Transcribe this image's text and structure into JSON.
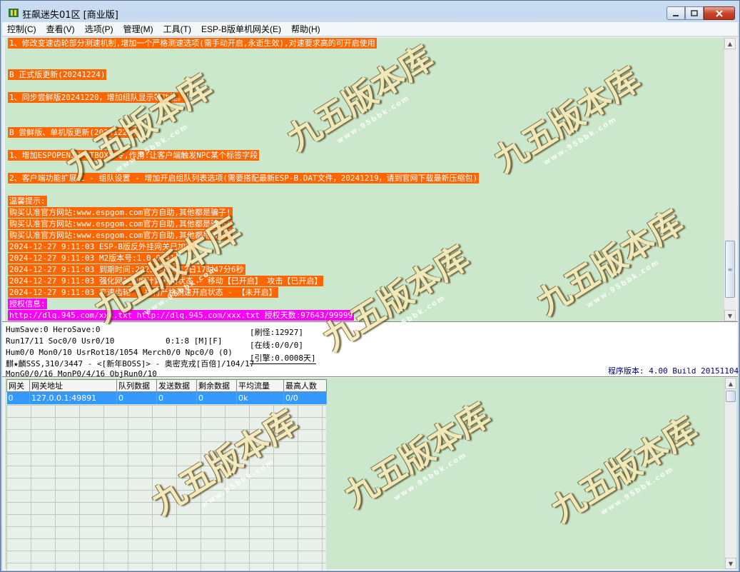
{
  "window": {
    "title": "狂飙迷失01区 [商业版]"
  },
  "menu": [
    "控制(C)",
    "查看(V)",
    "选项(P)",
    "管理(M)",
    "工具(T)",
    "ESP-B版单机网关(E)",
    "帮助(H)"
  ],
  "log": {
    "lines": [
      {
        "text": "1、修改变速齿轮部分测速机制,增加一个严格测速选项(需手动开启,永逝生效),对速要求高的可开启使用",
        "style": "orange"
      },
      {
        "text": "B 正式版更新(20241224)",
        "style": "orange"
      },
      {
        "text": "1、同步尝鲜版20241220，增加组队显示等功能。",
        "style": "orange"
      },
      {
        "text": "B 尝鲜版、单机版更新(20241220)",
        "style": "orange"
      },
      {
        "text": "1、增加ESPOPENINPUTBOX命令,作用:让客户端触发NPC某个标签字段",
        "style": "orange"
      },
      {
        "text": "2、客户端功能扩展二 - 组队设置 - 增加开启组队列表选项(需要搭配最新ESP-B.DAT文件，20241219，请到官网下载最新压缩包)",
        "style": "orange"
      },
      {
        "text": "温馨提示:",
        "style": "orange"
      },
      {
        "text": "购买认准官方网站:www.espgom.com官方自助,其他都是骗子!",
        "style": "orange"
      },
      {
        "text": "购买认准官方网站:www.espgom.com官方自助,其他都是骗子!",
        "style": "orange"
      },
      {
        "text": "购买认准官方网站:www.espgom.com官方自助,其他都是骗子!",
        "style": "orange"
      },
      {
        "text": "2024-12-27 9:11:03 ESP-B版反外挂网关已加载",
        "style": "orange"
      },
      {
        "text": "2024-12-27 9:11:03 M2版本号:1.0.0.41",
        "style": "orange"
      },
      {
        "text": "2024-12-27 9:11:03 到期时间:2025年11月12日17时47分6秒",
        "style": "orange"
      },
      {
        "text": "2024-12-27 9:11:03 强化网关速度计算开启状态 - 移动【已开启】 攻击【已开启】",
        "style": "orange"
      },
      {
        "text": "2024-12-27 9:11:03 变速齿轮 - 执行严格测速开启状态 - 【未开启】",
        "style": "orange"
      },
      {
        "text": "授权信息:",
        "style": "magenta"
      },
      {
        "text": "http://dlq.945.com/xxx.txt http://dlq.945.com/xxx.txt 授权天数:97643/99999",
        "style": "magenta"
      }
    ]
  },
  "status": {
    "hum_save": "HumSave:0 HeroSave:0",
    "run": "Run17/11 Soc0/0 Usr0/10",
    "time": "0:1:8 [M][F]",
    "hum": "Hum0/0 Mon0/10 UsrRot18/1054 Merch0/0 Npc0/0 (0)",
    "boss": "麒★麟SSS,310/3447 - <[新年BOSS]> - 奥密克戎[百倍]/104/17",
    "mon": "MonG0/0/16 MonP0/4/16 ObjRun0/10",
    "brush": "[刷怪:12927]",
    "online": "[在线:0/0/0]",
    "engine": "[引擎:0.0008天]",
    "version": "程序版本: 4.00 Build 20151104"
  },
  "gateway_table": {
    "headers": [
      "网关",
      "网关地址",
      "队列数据",
      "发送数据",
      "剩余数据",
      "平均流量",
      "最高人数"
    ],
    "rows": [
      [
        "0",
        "127.0.0.1:49891",
        "0",
        "0",
        "0",
        "0k",
        "0/0"
      ]
    ]
  },
  "watermark": {
    "text": "九五版本库",
    "url": "www.95bbk.com"
  }
}
